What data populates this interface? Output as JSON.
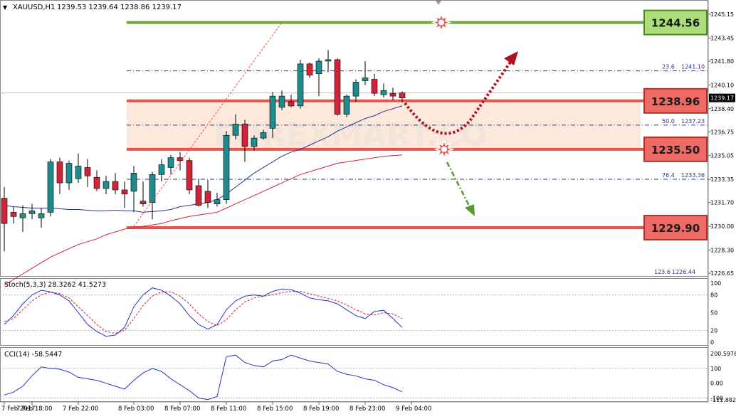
{
  "header": {
    "symbol": "XAUUSD,H1",
    "ohlc": "1239.53 1239.64 1238.86 1239.17"
  },
  "stoch_label": "Stoch(5,3,3) 28.3262 41.5273",
  "cci_label": "CCI(14) -58.5447",
  "watermark": "FOREXMART.CO",
  "colors": {
    "bull": "#1e8c8c",
    "bear": "#d0243a",
    "level_red": "#e8544c",
    "level_green": "#6aaa3a",
    "zone_fill": "#fde9dc",
    "ma_red": "#d0243a",
    "ma_blue": "#24348c",
    "stoch_main": "#2433c8",
    "stoch_signal": "#d0243a",
    "cci": "#2433c8",
    "arrow_up": "#b0101c",
    "arrow_down": "#5a9a2a"
  },
  "chart_data": {
    "type": "candlestick",
    "symbol": "XAUUSD",
    "timeframe": "H1",
    "ylim": [
      1226.65,
      1245.15
    ],
    "y_tick_labels": [
      "1245.15",
      "1243.45",
      "1241.80",
      "1240.10",
      "1238.40",
      "1236.75",
      "1235.05",
      "1233.35",
      "1231.70",
      "1230.00",
      "1228.30",
      "1226.65"
    ],
    "x_tick_labels": [
      "7 Feb 2017",
      "7 Feb 18:00",
      "7 Feb 22:00",
      "8 Feb 03:00",
      "8 Feb 07:00",
      "8 Feb 11:00",
      "8 Feb 15:00",
      "8 Feb 19:00",
      "8 Feb 23:00",
      "9 Feb 04:00"
    ],
    "candles": [
      {
        "o": 1232.0,
        "h": 1232.8,
        "l": 1228.2,
        "c": 1230.2
      },
      {
        "o": 1231.0,
        "h": 1231.4,
        "l": 1230.2,
        "c": 1230.7
      },
      {
        "o": 1230.6,
        "h": 1231.5,
        "l": 1229.6,
        "c": 1230.9
      },
      {
        "o": 1230.9,
        "h": 1231.6,
        "l": 1230.5,
        "c": 1231.1
      },
      {
        "o": 1230.6,
        "h": 1231.3,
        "l": 1229.9,
        "c": 1230.9
      },
      {
        "o": 1231.0,
        "h": 1234.8,
        "l": 1230.7,
        "c": 1234.6
      },
      {
        "o": 1234.6,
        "h": 1234.9,
        "l": 1232.3,
        "c": 1233.1
      },
      {
        "o": 1233.1,
        "h": 1234.7,
        "l": 1232.6,
        "c": 1234.5
      },
      {
        "o": 1233.4,
        "h": 1235.2,
        "l": 1233.1,
        "c": 1234.3
      },
      {
        "o": 1234.2,
        "h": 1234.8,
        "l": 1232.8,
        "c": 1233.6
      },
      {
        "o": 1233.5,
        "h": 1234.0,
        "l": 1232.5,
        "c": 1232.7
      },
      {
        "o": 1232.7,
        "h": 1233.6,
        "l": 1232.3,
        "c": 1233.2
      },
      {
        "o": 1233.2,
        "h": 1233.8,
        "l": 1232.3,
        "c": 1232.6
      },
      {
        "o": 1232.6,
        "h": 1233.2,
        "l": 1231.3,
        "c": 1232.3
      },
      {
        "o": 1232.5,
        "h": 1234.3,
        "l": 1231.0,
        "c": 1233.8
      },
      {
        "o": 1231.8,
        "h": 1233.2,
        "l": 1231.4,
        "c": 1231.6
      },
      {
        "o": 1231.7,
        "h": 1233.9,
        "l": 1230.5,
        "c": 1233.7
      },
      {
        "o": 1233.7,
        "h": 1234.8,
        "l": 1233.2,
        "c": 1234.4
      },
      {
        "o": 1234.2,
        "h": 1235.1,
        "l": 1233.7,
        "c": 1234.9
      },
      {
        "o": 1234.9,
        "h": 1235.3,
        "l": 1234.0,
        "c": 1234.7
      },
      {
        "o": 1234.7,
        "h": 1234.9,
        "l": 1232.3,
        "c": 1232.6
      },
      {
        "o": 1232.9,
        "h": 1233.4,
        "l": 1231.4,
        "c": 1231.5
      },
      {
        "o": 1232.5,
        "h": 1233.3,
        "l": 1231.3,
        "c": 1231.7
      },
      {
        "o": 1231.6,
        "h": 1232.4,
        "l": 1231.4,
        "c": 1231.9
      },
      {
        "o": 1231.9,
        "h": 1236.8,
        "l": 1231.6,
        "c": 1236.5
      },
      {
        "o": 1236.5,
        "h": 1238.0,
        "l": 1236.2,
        "c": 1237.3
      },
      {
        "o": 1237.3,
        "h": 1237.6,
        "l": 1234.6,
        "c": 1235.7
      },
      {
        "o": 1235.7,
        "h": 1236.5,
        "l": 1235.4,
        "c": 1236.3
      },
      {
        "o": 1236.3,
        "h": 1236.9,
        "l": 1236.2,
        "c": 1236.7
      },
      {
        "o": 1237.0,
        "h": 1239.6,
        "l": 1236.3,
        "c": 1239.3
      },
      {
        "o": 1238.5,
        "h": 1239.7,
        "l": 1238.3,
        "c": 1239.3
      },
      {
        "o": 1238.9,
        "h": 1239.4,
        "l": 1238.5,
        "c": 1238.6
      },
      {
        "o": 1238.6,
        "h": 1241.9,
        "l": 1238.4,
        "c": 1241.6
      },
      {
        "o": 1241.6,
        "h": 1241.7,
        "l": 1240.6,
        "c": 1240.8
      },
      {
        "o": 1240.9,
        "h": 1242.0,
        "l": 1239.3,
        "c": 1241.8
      },
      {
        "o": 1241.8,
        "h": 1242.6,
        "l": 1241.0,
        "c": 1241.9
      },
      {
        "o": 1241.9,
        "h": 1242.0,
        "l": 1237.9,
        "c": 1238.0
      },
      {
        "o": 1238.0,
        "h": 1239.4,
        "l": 1237.8,
        "c": 1239.3
      },
      {
        "o": 1239.3,
        "h": 1240.5,
        "l": 1238.9,
        "c": 1240.3
      },
      {
        "o": 1240.4,
        "h": 1241.8,
        "l": 1240.1,
        "c": 1240.6
      },
      {
        "o": 1240.5,
        "h": 1240.9,
        "l": 1239.3,
        "c": 1239.5
      },
      {
        "o": 1239.4,
        "h": 1240.2,
        "l": 1239.2,
        "c": 1239.7
      },
      {
        "o": 1239.5,
        "h": 1239.9,
        "l": 1239.0,
        "c": 1239.3
      },
      {
        "o": 1239.53,
        "h": 1239.64,
        "l": 1238.86,
        "c": 1239.17
      }
    ],
    "horizontal_levels": [
      {
        "label": "1244.56",
        "value": 1244.56,
        "color": "green"
      },
      {
        "label": "1238.96",
        "value": 1238.96,
        "color": "red"
      },
      {
        "label": "1235.50",
        "value": 1235.5,
        "color": "red"
      },
      {
        "label": "1229.90",
        "value": 1229.9,
        "color": "red"
      }
    ],
    "fibonacci": [
      {
        "ratio": "23.6",
        "price": "1241.10"
      },
      {
        "ratio": "50.0",
        "price": "1237.23"
      },
      {
        "ratio": "76.4",
        "price": "1233.36"
      },
      {
        "ratio": "123.6",
        "price": "1226.44"
      }
    ],
    "current_price": "1239.17",
    "ma_blue": [
      1231.5,
      1231.4,
      1231.35,
      1231.3,
      1231.3,
      1231.3,
      1231.25,
      1231.2,
      1231.2,
      1231.15,
      1231.1,
      1231.1,
      1231.15,
      1231.1,
      1231.1,
      1231.0,
      1231.05,
      1231.1,
      1231.2,
      1231.4,
      1231.5,
      1231.6,
      1231.7,
      1231.9,
      1232.3,
      1232.8,
      1233.3,
      1233.8,
      1234.2,
      1234.6,
      1235.0,
      1235.3,
      1235.5,
      1235.8,
      1236.1,
      1236.4,
      1236.8,
      1237.1,
      1237.4,
      1237.7,
      1237.9,
      1238.2,
      1238.4,
      1238.6
    ],
    "ma_red": [
      1225.8,
      1226.2,
      1226.6,
      1227.0,
      1227.4,
      1227.8,
      1228.1,
      1228.4,
      1228.7,
      1228.9,
      1229.1,
      1229.4,
      1229.6,
      1229.8,
      1229.9,
      1230.0,
      1230.1,
      1230.2,
      1230.4,
      1230.55,
      1230.7,
      1230.8,
      1230.9,
      1231.0,
      1231.3,
      1231.6,
      1231.9,
      1232.2,
      1232.5,
      1232.8,
      1233.1,
      1233.4,
      1233.7,
      1233.9,
      1234.1,
      1234.3,
      1234.5,
      1234.6,
      1234.7,
      1234.8,
      1234.9,
      1235.0,
      1235.05,
      1235.1
    ],
    "stoch": {
      "ylim": [
        0,
        100
      ],
      "tick_labels": [
        "100",
        "80",
        "50",
        "20",
        "0"
      ],
      "main": [
        30,
        45,
        65,
        80,
        88,
        85,
        80,
        70,
        50,
        30,
        18,
        10,
        12,
        25,
        60,
        80,
        92,
        88,
        78,
        65,
        45,
        30,
        22,
        30,
        55,
        70,
        78,
        80,
        78,
        86,
        90,
        89,
        83,
        75,
        72,
        70,
        65,
        55,
        45,
        40,
        52,
        54,
        40,
        25
      ],
      "signal": [
        35,
        40,
        55,
        70,
        80,
        85,
        82,
        75,
        60,
        45,
        30,
        18,
        15,
        20,
        40,
        62,
        78,
        85,
        85,
        78,
        65,
        48,
        35,
        28,
        38,
        55,
        68,
        75,
        78,
        80,
        84,
        86,
        86,
        82,
        78,
        74,
        70,
        63,
        55,
        48,
        46,
        50,
        48,
        40
      ]
    },
    "cci": {
      "ylim": [
        -112,
        215
      ],
      "tick_labels": [
        "200.5976",
        "100",
        "0.00",
        "-100",
        "-111.8822"
      ],
      "values": [
        -80,
        -60,
        -20,
        50,
        110,
        100,
        95,
        75,
        40,
        30,
        20,
        0,
        -20,
        -40,
        20,
        70,
        100,
        80,
        30,
        -10,
        -50,
        -100,
        -110,
        -90,
        180,
        190,
        140,
        120,
        110,
        150,
        160,
        190,
        170,
        150,
        140,
        130,
        80,
        60,
        50,
        30,
        20,
        -10,
        -30,
        -58
      ]
    }
  }
}
